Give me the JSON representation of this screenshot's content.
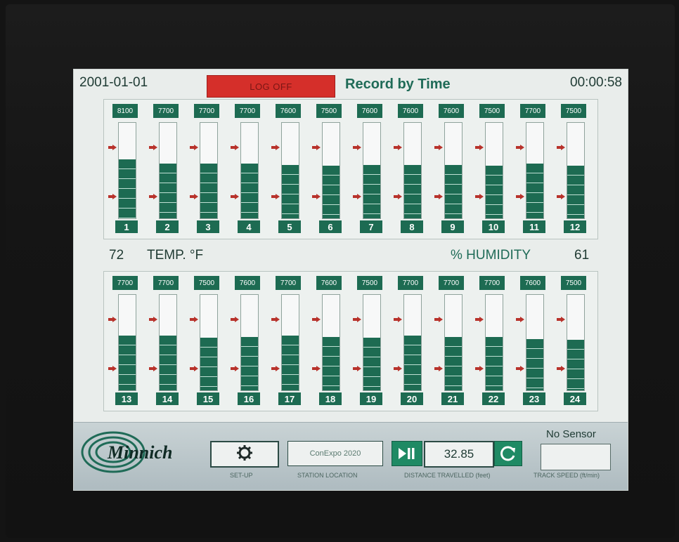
{
  "header": {
    "date": "2001-01-01",
    "log_off_label": "LOG OFF",
    "mode_title": "Record by Time",
    "clock": "00:00:58"
  },
  "top_gauges": [
    {
      "value": "8100",
      "number": "1",
      "level": 0.62
    },
    {
      "value": "7700",
      "number": "2",
      "level": 0.57
    },
    {
      "value": "7700",
      "number": "3",
      "level": 0.57
    },
    {
      "value": "7700",
      "number": "4",
      "level": 0.57
    },
    {
      "value": "7600",
      "number": "5",
      "level": 0.56
    },
    {
      "value": "7500",
      "number": "6",
      "level": 0.55
    },
    {
      "value": "7600",
      "number": "7",
      "level": 0.56
    },
    {
      "value": "7600",
      "number": "8",
      "level": 0.56
    },
    {
      "value": "7600",
      "number": "9",
      "level": 0.56
    },
    {
      "value": "7500",
      "number": "10",
      "level": 0.55
    },
    {
      "value": "7700",
      "number": "11",
      "level": 0.57
    },
    {
      "value": "7500",
      "number": "12",
      "level": 0.55
    }
  ],
  "environment": {
    "temperature_value": "72",
    "temperature_label": "TEMP. °F",
    "humidity_label": "% HUMIDITY",
    "humidity_value": "61"
  },
  "bottom_gauges": [
    {
      "value": "7700",
      "number": "13",
      "level": 0.57
    },
    {
      "value": "7700",
      "number": "14",
      "level": 0.57
    },
    {
      "value": "7500",
      "number": "15",
      "level": 0.55
    },
    {
      "value": "7600",
      "number": "16",
      "level": 0.56
    },
    {
      "value": "7700",
      "number": "17",
      "level": 0.57
    },
    {
      "value": "7600",
      "number": "18",
      "level": 0.56
    },
    {
      "value": "7500",
      "number": "19",
      "level": 0.55
    },
    {
      "value": "7700",
      "number": "20",
      "level": 0.57
    },
    {
      "value": "7700",
      "number": "21",
      "level": 0.56
    },
    {
      "value": "7700",
      "number": "22",
      "level": 0.56
    },
    {
      "value": "7600",
      "number": "23",
      "level": 0.54
    },
    {
      "value": "7500",
      "number": "24",
      "level": 0.53
    }
  ],
  "footer": {
    "brand": "Minnich",
    "setup_label": "SET-UP",
    "station_value": "ConExpo 2020",
    "station_label": "STATION LOCATION",
    "distance_value": "32.85",
    "distance_label": "DISTANCE TRAVELLED (feet)",
    "sensor_status": "No Sensor",
    "speed_value": "",
    "speed_label": "TRACK SPEED (ft/min)",
    "icons": {
      "setup": "gear-icon",
      "play_pause": "play-pause-icon",
      "reset": "refresh-icon"
    }
  },
  "colors": {
    "accent_green": "#1d6b52",
    "alert_red": "#d52f2a",
    "marker_red": "#b8322b",
    "screen_bg": "#e9edeb"
  }
}
